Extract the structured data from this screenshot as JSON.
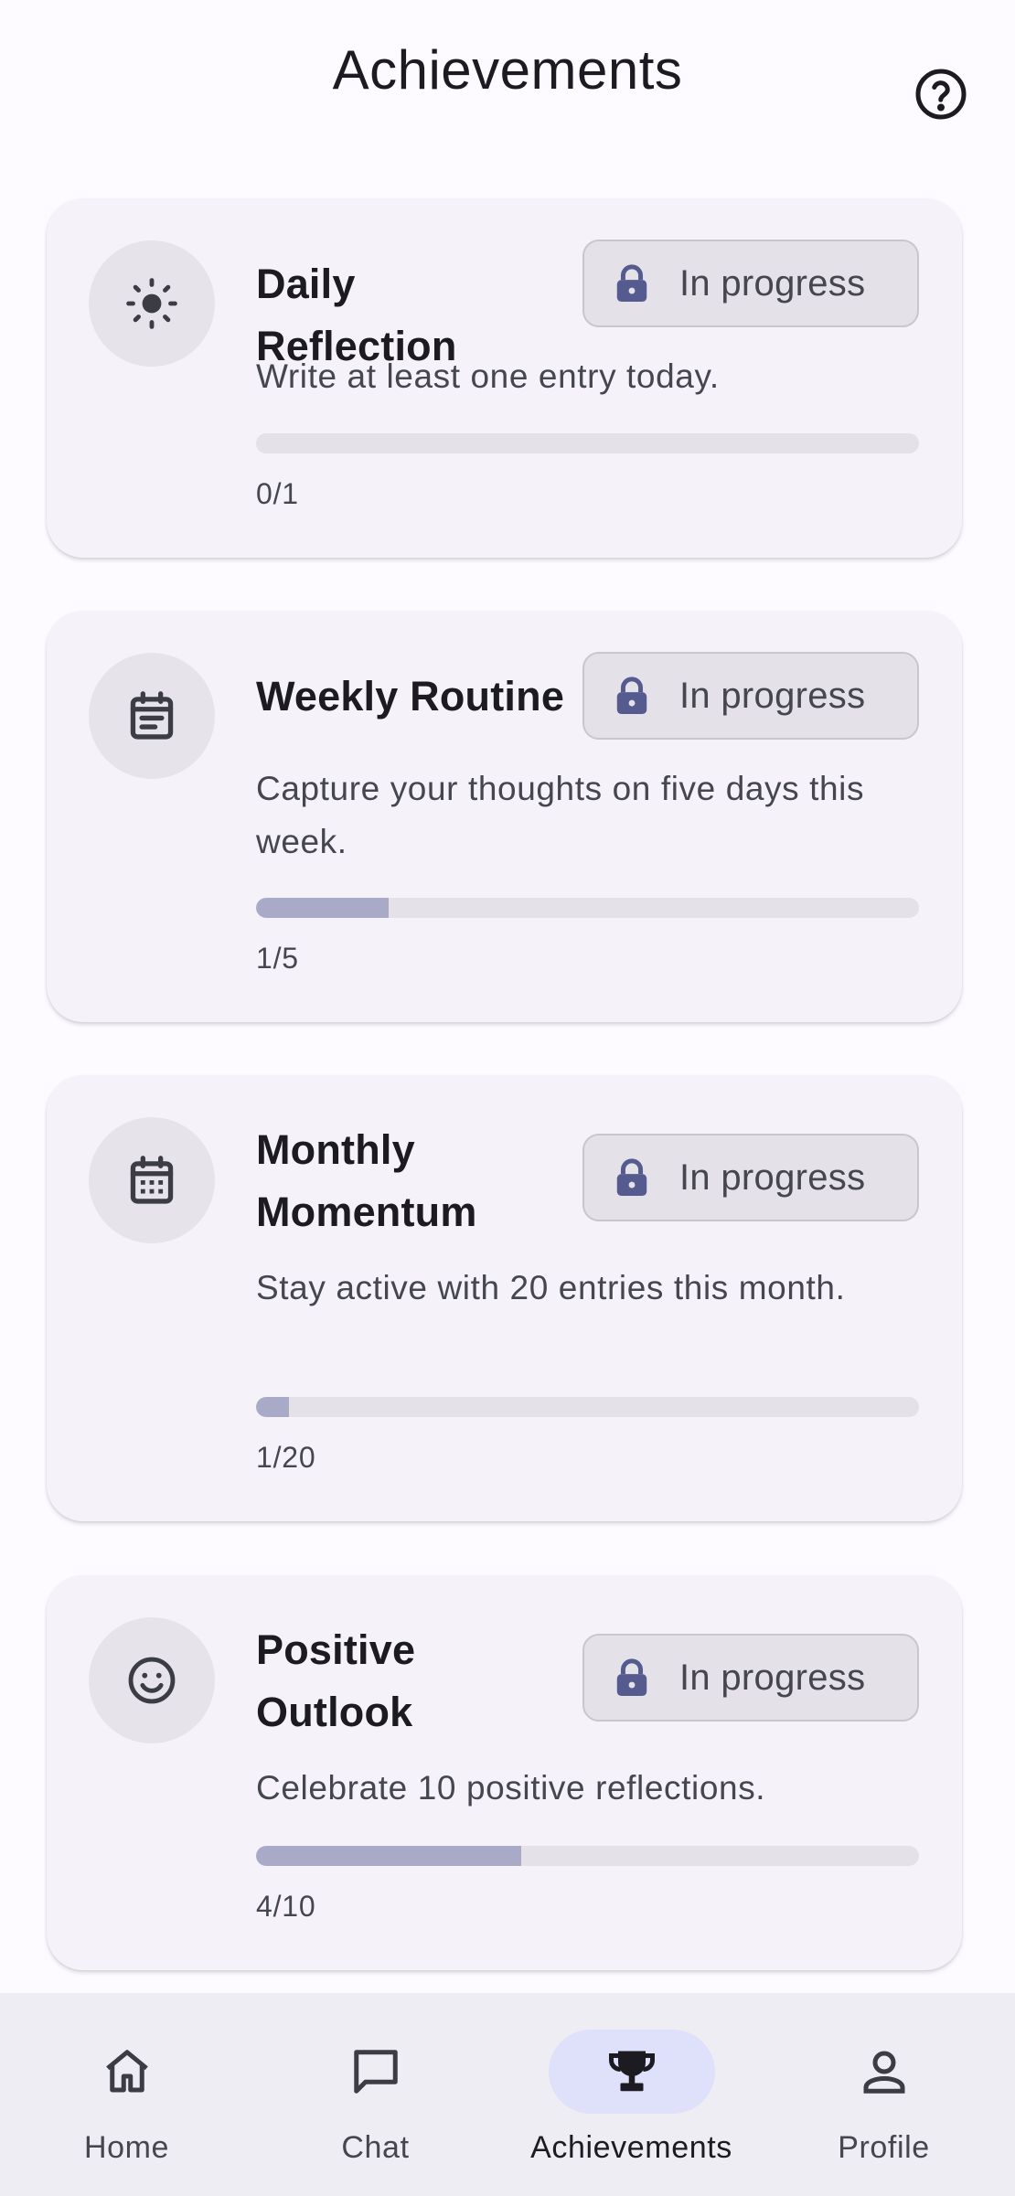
{
  "header": {
    "title": "Achievements",
    "help_icon": "help-circle-icon"
  },
  "achievements": [
    {
      "icon": "sun-icon",
      "title": "Daily Reflection",
      "status": "In progress",
      "status_icon": "lock-icon",
      "description": "Write at least one entry today.",
      "progress_text": "0/1",
      "progress_fraction": 0
    },
    {
      "icon": "calendar-note-icon",
      "title": "Weekly Routine",
      "status": "In progress",
      "status_icon": "lock-icon",
      "description": "Capture your thoughts on five days this week.",
      "progress_text": "1/5",
      "progress_fraction": 0.2
    },
    {
      "icon": "calendar-month-icon",
      "title": "Monthly Momentum",
      "status": "In progress",
      "status_icon": "lock-icon",
      "description": "Stay active with 20 entries this month.",
      "progress_text": "1/20",
      "progress_fraction": 0.05
    },
    {
      "icon": "smiley-icon",
      "title": "Positive Outlook",
      "status": "In progress",
      "status_icon": "lock-icon",
      "description": "Celebrate 10 positive reflections.",
      "progress_text": "4/10",
      "progress_fraction": 0.4
    }
  ],
  "bottom_nav": {
    "items": [
      {
        "label": "Home",
        "icon": "home-icon",
        "active": false
      },
      {
        "label": "Chat",
        "icon": "chat-icon",
        "active": false
      },
      {
        "label": "Achievements",
        "icon": "trophy-icon",
        "active": true
      },
      {
        "label": "Profile",
        "icon": "person-icon",
        "active": false
      }
    ]
  },
  "colors": {
    "accent": "#565b8f",
    "progress_fill": "#a8aac8",
    "progress_track": "#e4e1e9",
    "card_background": "#f5f2f9",
    "nav_active_indicator": "#dfe0f9"
  }
}
